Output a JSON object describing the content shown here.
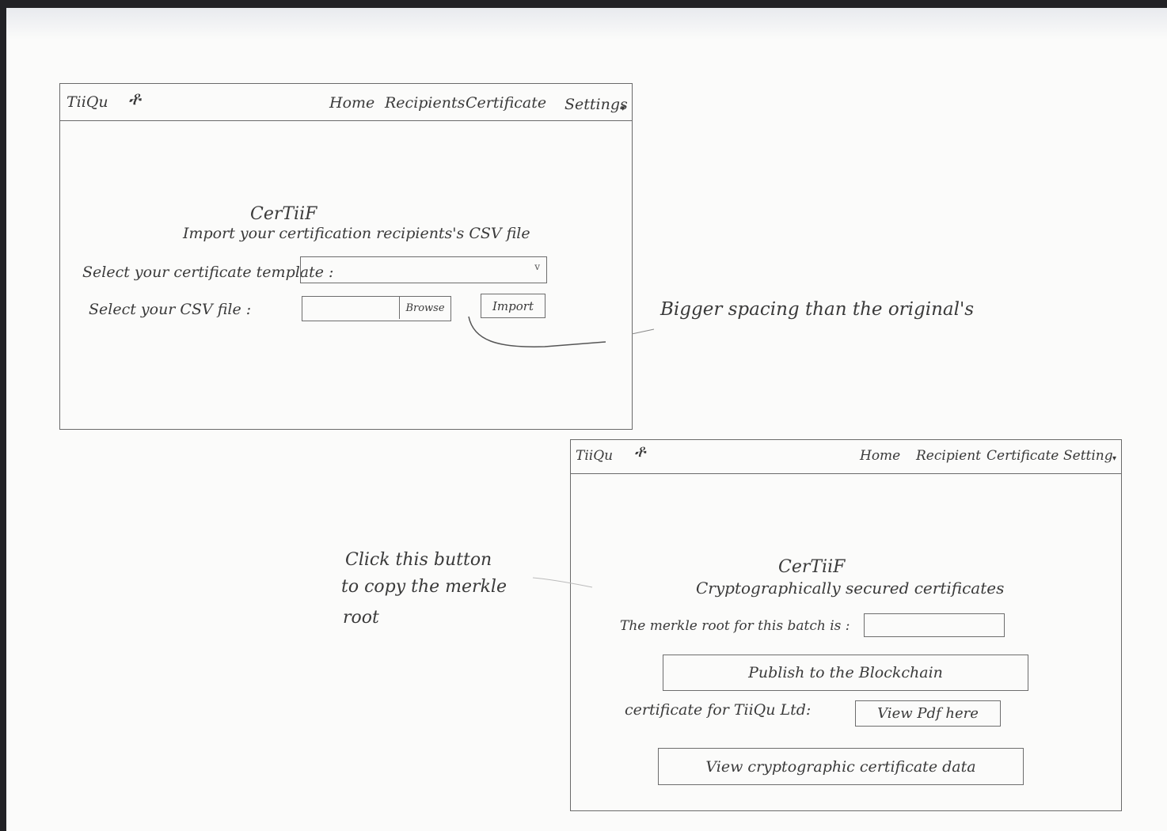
{
  "wireframe_1": {
    "logo": "TiiQu",
    "nav": [
      "Home",
      "Recipients",
      "Certificate",
      "Settings"
    ],
    "settings_caret": "▾",
    "title": "CerTiiF",
    "subtitle": "Import your certification recipients's CSV file",
    "template_label": "Select your certificate template :",
    "template_caret": "v",
    "csv_label": "Select your CSV file :",
    "browse_label": "Browse",
    "import_label": "Import"
  },
  "annotation_spacing": "Bigger spacing than the original's",
  "annotation_copy": [
    "Click this button",
    "to copy the merkle",
    "root"
  ],
  "wireframe_2": {
    "logo": "TiiQu",
    "nav": [
      "Home",
      "Recipient",
      "Certificate",
      "Setting"
    ],
    "settings_caret": "▾",
    "title": "CerTiiF",
    "subtitle": "Cryptographically secured certificates",
    "merkle_label": "The merkle root for this batch is :",
    "publish_label": "Publish to the Blockchain",
    "cert_label": "certificate for TiiQu Ltd:",
    "view_pdf_label": "View Pdf here",
    "view_crypto_label": "View cryptographic certificate data"
  }
}
